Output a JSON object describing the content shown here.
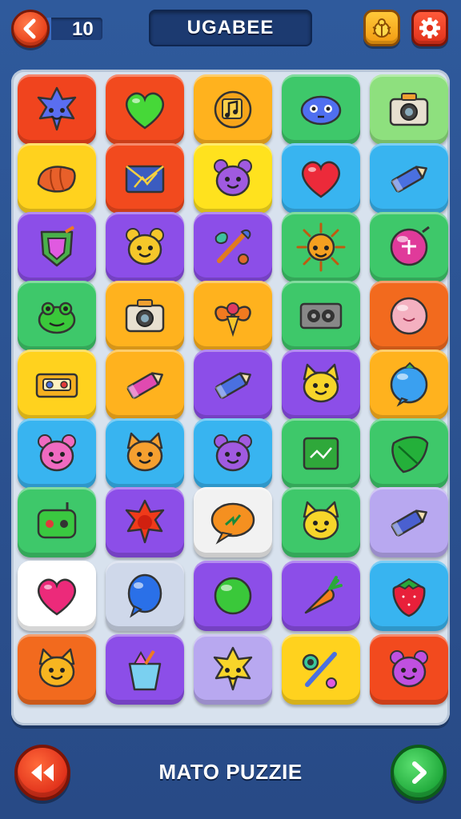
{
  "header": {
    "count": "10",
    "title": "UGABEE"
  },
  "footer": {
    "title": "MATO PUZZIE"
  },
  "board": {
    "rows": 9,
    "cols": 5,
    "tiles": [
      {
        "icon": "star-face-icon",
        "bg": "#f0441e"
      },
      {
        "icon": "green-heart-icon",
        "bg": "#f24a1e"
      },
      {
        "icon": "music-note-icon",
        "bg": "#ffb21e"
      },
      {
        "icon": "blue-blob-icon",
        "bg": "#3ec86a"
      },
      {
        "icon": "camera-icon",
        "bg": "#8ee07e"
      },
      {
        "icon": "croissant-icon",
        "bg": "#ffd21e"
      },
      {
        "icon": "envelope-icon",
        "bg": "#f24a1e"
      },
      {
        "icon": "purple-bear-icon",
        "bg": "#ffe21e"
      },
      {
        "icon": "red-heart-icon",
        "bg": "#38b4f0"
      },
      {
        "icon": "blue-crayon-icon",
        "bg": "#38b4f0"
      },
      {
        "icon": "gem-shield-icon",
        "bg": "#8c4ee8"
      },
      {
        "icon": "yellow-bear-icon",
        "bg": "#8c4ee8"
      },
      {
        "icon": "paintbrush-icon",
        "bg": "#8c4ee8"
      },
      {
        "icon": "sun-icon",
        "bg": "#3ec86a"
      },
      {
        "icon": "pink-pin-icon",
        "bg": "#3ec86a"
      },
      {
        "icon": "green-frog-icon",
        "bg": "#3ec86a"
      },
      {
        "icon": "camera-icon",
        "bg": "#ffb21e"
      },
      {
        "icon": "bow-icon",
        "bg": "#ffb21e"
      },
      {
        "icon": "speaker-icon",
        "bg": "#3ec86a"
      },
      {
        "icon": "pink-ball-icon",
        "bg": "#f26a1e"
      },
      {
        "icon": "cassette-icon",
        "bg": "#ffd21e"
      },
      {
        "icon": "pink-crayon-icon",
        "bg": "#ffb21e"
      },
      {
        "icon": "blue-crayon-icon",
        "bg": "#8c4ee8"
      },
      {
        "icon": "yellow-cat-icon",
        "bg": "#8c4ee8"
      },
      {
        "icon": "blue-bubble-icon",
        "bg": "#ffb21e"
      },
      {
        "icon": "pink-bear-icon",
        "bg": "#38b4f0"
      },
      {
        "icon": "orange-fox-icon",
        "bg": "#38b4f0"
      },
      {
        "icon": "purple-bear-icon",
        "bg": "#38b4f0"
      },
      {
        "icon": "green-box-icon",
        "bg": "#3ec86a"
      },
      {
        "icon": "green-leaf-icon",
        "bg": "#3ec86a"
      },
      {
        "icon": "green-robot-icon",
        "bg": "#3ec86a"
      },
      {
        "icon": "red-star-icon",
        "bg": "#8c4ee8"
      },
      {
        "icon": "orange-bubble-icon",
        "bg": "#f2f2f2"
      },
      {
        "icon": "yellow-cat-icon",
        "bg": "#3ec86a"
      },
      {
        "icon": "blue-pencil-icon",
        "bg": "#b8a8f0"
      },
      {
        "icon": "pink-heart-icon",
        "bg": "#ffffff"
      },
      {
        "icon": "blue-balloon-icon",
        "bg": "#cfd8ea"
      },
      {
        "icon": "green-orb-icon",
        "bg": "#8c4ee8"
      },
      {
        "icon": "carrot-icon",
        "bg": "#8c4ee8"
      },
      {
        "icon": "strawberry-icon",
        "bg": "#38b4f0"
      },
      {
        "icon": "orange-cat-icon",
        "bg": "#f26a1e"
      },
      {
        "icon": "cup-icon",
        "bg": "#8c4ee8"
      },
      {
        "icon": "sun-face-icon",
        "bg": "#b8a8f0"
      },
      {
        "icon": "tools-icon",
        "bg": "#ffd21e"
      },
      {
        "icon": "pink-monster-icon",
        "bg": "#f24a1e"
      }
    ]
  }
}
